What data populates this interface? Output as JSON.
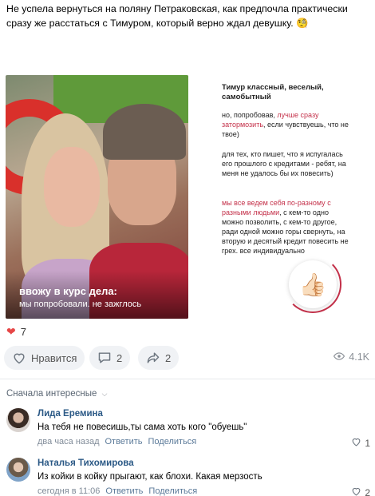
{
  "post": {
    "text": "Не успела вернуться на поляну Петраковская, как предпочла практически сразу же расстаться с Тимуром, который верно ждал девушку. 🧐"
  },
  "media": {
    "photo_caption_title": "ввожу в курс дела:",
    "photo_caption_sub": "мы попробовали. не зажглось",
    "slide": {
      "title": "Тимур классный, веселый, самобытный",
      "p1_before": "но, попробовав, ",
      "p1_red": "лучше сразу затормозить",
      "p1_after": ", если чувствуешь, что не твое)",
      "p2": "для тех, кто пишет, что я испугалась его прошлого с кредитами - ребят, на меня не удалось бы их повесить)",
      "p3_red": "мы все ведем себя по-разному с разными людьми",
      "p3_after": ", с кем-то одно можно позволить, с кем-то другое, ради одной можно горы свернуть, на вторую и десятый кредит повесить не грех. все индивидуально",
      "thumb_emoji": "👍🏻"
    }
  },
  "stats": {
    "likes_count": "7",
    "like_button_label": "Нравится",
    "comments_count": "2",
    "shares_count": "2",
    "views_count": "4.1K"
  },
  "comments_section": {
    "sort_label": "Сначала интересные"
  },
  "comments": [
    {
      "author": "Лида Еремина",
      "text": "На тебя не повесишь,ты сама хоть кого \"обуешь\"",
      "time": "два часа назад",
      "reply_label": "Ответить",
      "share_label": "Поделиться",
      "likes": "1"
    },
    {
      "author": "Наталья Тихомирова",
      "text": "Из койки в койку прыгают, как блохи. Какая мерзость",
      "time": "сегодня в 11:06",
      "reply_label": "Ответить",
      "share_label": "Поделиться",
      "likes": "2"
    }
  ],
  "colors": {
    "accent_red": "#c4314a",
    "link_blue": "#2a5885",
    "heart_red": "#e64646",
    "pill_bg": "#f0f2f5"
  }
}
